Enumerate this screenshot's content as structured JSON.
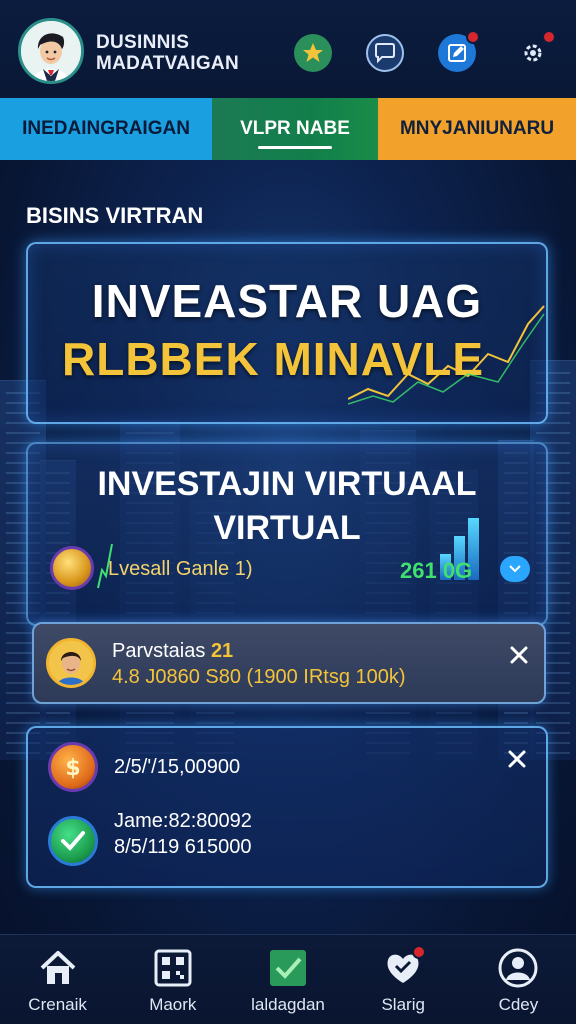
{
  "header": {
    "brand_line1": "DUSINNIS",
    "brand_line2": "MADATVAIGAN",
    "icons": [
      "trophy-icon",
      "chat-icon",
      "edit-icon",
      "settings-icon"
    ]
  },
  "tabs": [
    {
      "label": "INEDAINGRAIGAN",
      "color": "#1aa0e0"
    },
    {
      "label": "VLPR NABE",
      "color": "#127f4b",
      "active": true
    },
    {
      "label": "MNYJANIUNARU",
      "color": "#f2a22b"
    }
  ],
  "section": {
    "title": "BISINS VIRTRAN"
  },
  "hero": {
    "title": "INVEASTAR UAG",
    "subtitle": "RLBBEK MINAVLE"
  },
  "investment": {
    "title_line1": "INVESTAJIN VIRTUAAL",
    "title_line2": "VIRTUAL",
    "label": "Lvesall Ganle 1)",
    "value": "261 0G"
  },
  "notification": {
    "name": "Parvstaias",
    "name_highlight": "21",
    "detail": "4.8 J0860 S80 (1900 IRtsg 100k)"
  },
  "transactions": [
    {
      "text": "2/5/'/15,00900",
      "icon": "dollar-coin-icon"
    },
    {
      "text": "Jame:82:80092",
      "text2": "8/5/119 615000",
      "icon": "check-icon"
    }
  ],
  "bottom_nav": [
    {
      "label": "Crenaik",
      "icon": "home-icon"
    },
    {
      "label": "Maork",
      "icon": "grid-icon"
    },
    {
      "label": "laldagdan",
      "icon": "check-box-icon"
    },
    {
      "label": "Slarig",
      "icon": "heart-chat-icon"
    },
    {
      "label": "Cdey",
      "icon": "profile-icon"
    }
  ],
  "colors": {
    "accent_gold": "#f3c33a",
    "accent_green": "#3fe06e",
    "badge_red": "#d8262d"
  }
}
